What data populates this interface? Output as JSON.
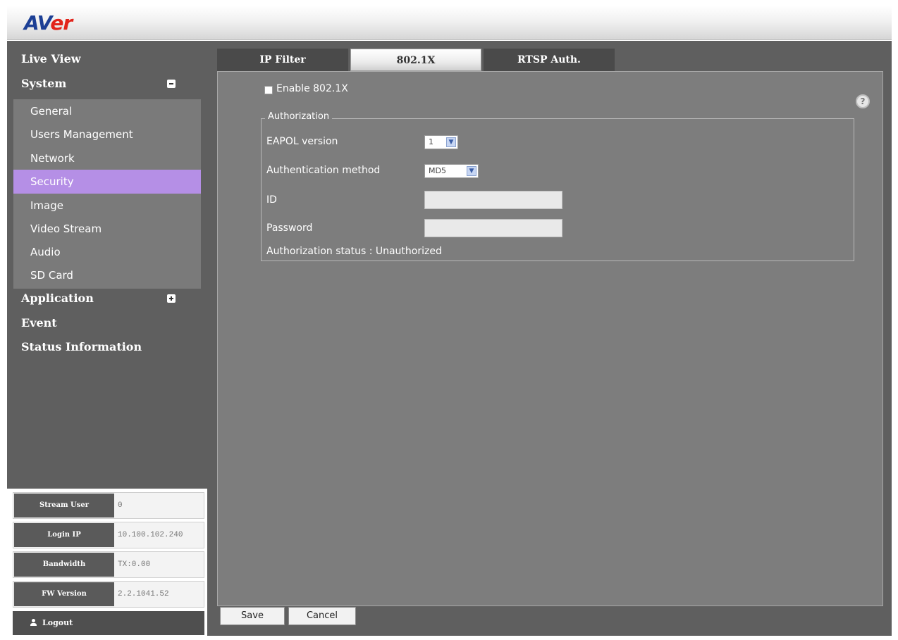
{
  "header": {
    "logo_main": "AV",
    "logo_accent": "er"
  },
  "sidebar": {
    "live_view": "Live View",
    "system": "System",
    "system_items": [
      "General",
      "Users Management",
      "Network",
      "Security",
      "Image",
      "Video Stream",
      "Audio",
      "SD Card"
    ],
    "active_item": "Security",
    "application": "Application",
    "event": "Event",
    "status_information": "Status Information"
  },
  "info": {
    "stream_user_label": "Stream User",
    "stream_user_value": "0",
    "login_ip_label": "Login IP",
    "login_ip_value": "10.100.102.240",
    "bandwidth_label": "Bandwidth",
    "bandwidth_value": "TX:0.00",
    "fw_version_label": "FW Version",
    "fw_version_value": "2.2.1041.52"
  },
  "logout_label": "Logout",
  "tabs": [
    "IP Filter",
    "802.1X",
    "RTSP Auth."
  ],
  "active_tab": "802.1X",
  "form": {
    "enable_label": "Enable 802.1X",
    "enable_checked": false,
    "legend": "Authorization",
    "eapol_label": "EAPOL version",
    "eapol_value": "1",
    "auth_method_label": "Authentication method",
    "auth_method_value": "MD5",
    "id_label": "ID",
    "id_value": "",
    "password_label": "Password",
    "password_value": "",
    "status_text": "Authorization status : Unauthorized"
  },
  "help_glyph": "?",
  "buttons": {
    "save": "Save",
    "cancel": "Cancel"
  }
}
